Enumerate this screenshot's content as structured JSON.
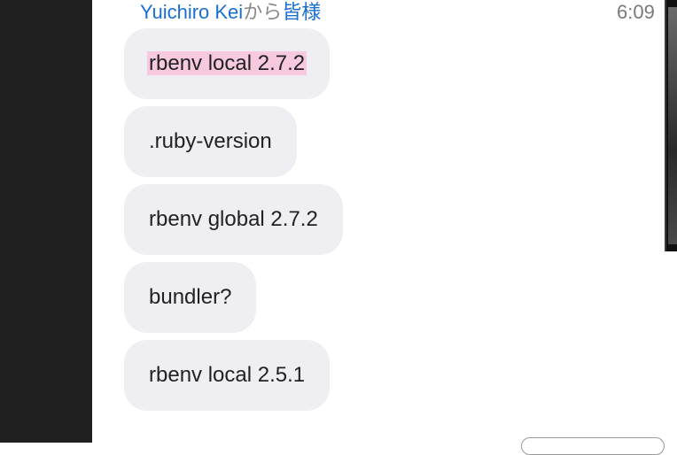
{
  "header": {
    "sender_name": "Yuichiro Kei",
    "sender_kara": "から",
    "sender_recipients": "皆様",
    "timestamp": "6:09"
  },
  "messages": [
    {
      "text": "rbenv local 2.7.2",
      "highlighted": true
    },
    {
      "text": ".ruby-version",
      "highlighted": false
    },
    {
      "text": "rbenv global 2.7.2",
      "highlighted": false
    },
    {
      "text": "bundler?",
      "highlighted": false
    },
    {
      "text": "rbenv local 2.5.1",
      "highlighted": false
    }
  ],
  "colors": {
    "sender": "#1a6fd1",
    "bubble": "#efeff3",
    "highlight": "#f7c9df",
    "sidebar": "#1f1f1f"
  }
}
